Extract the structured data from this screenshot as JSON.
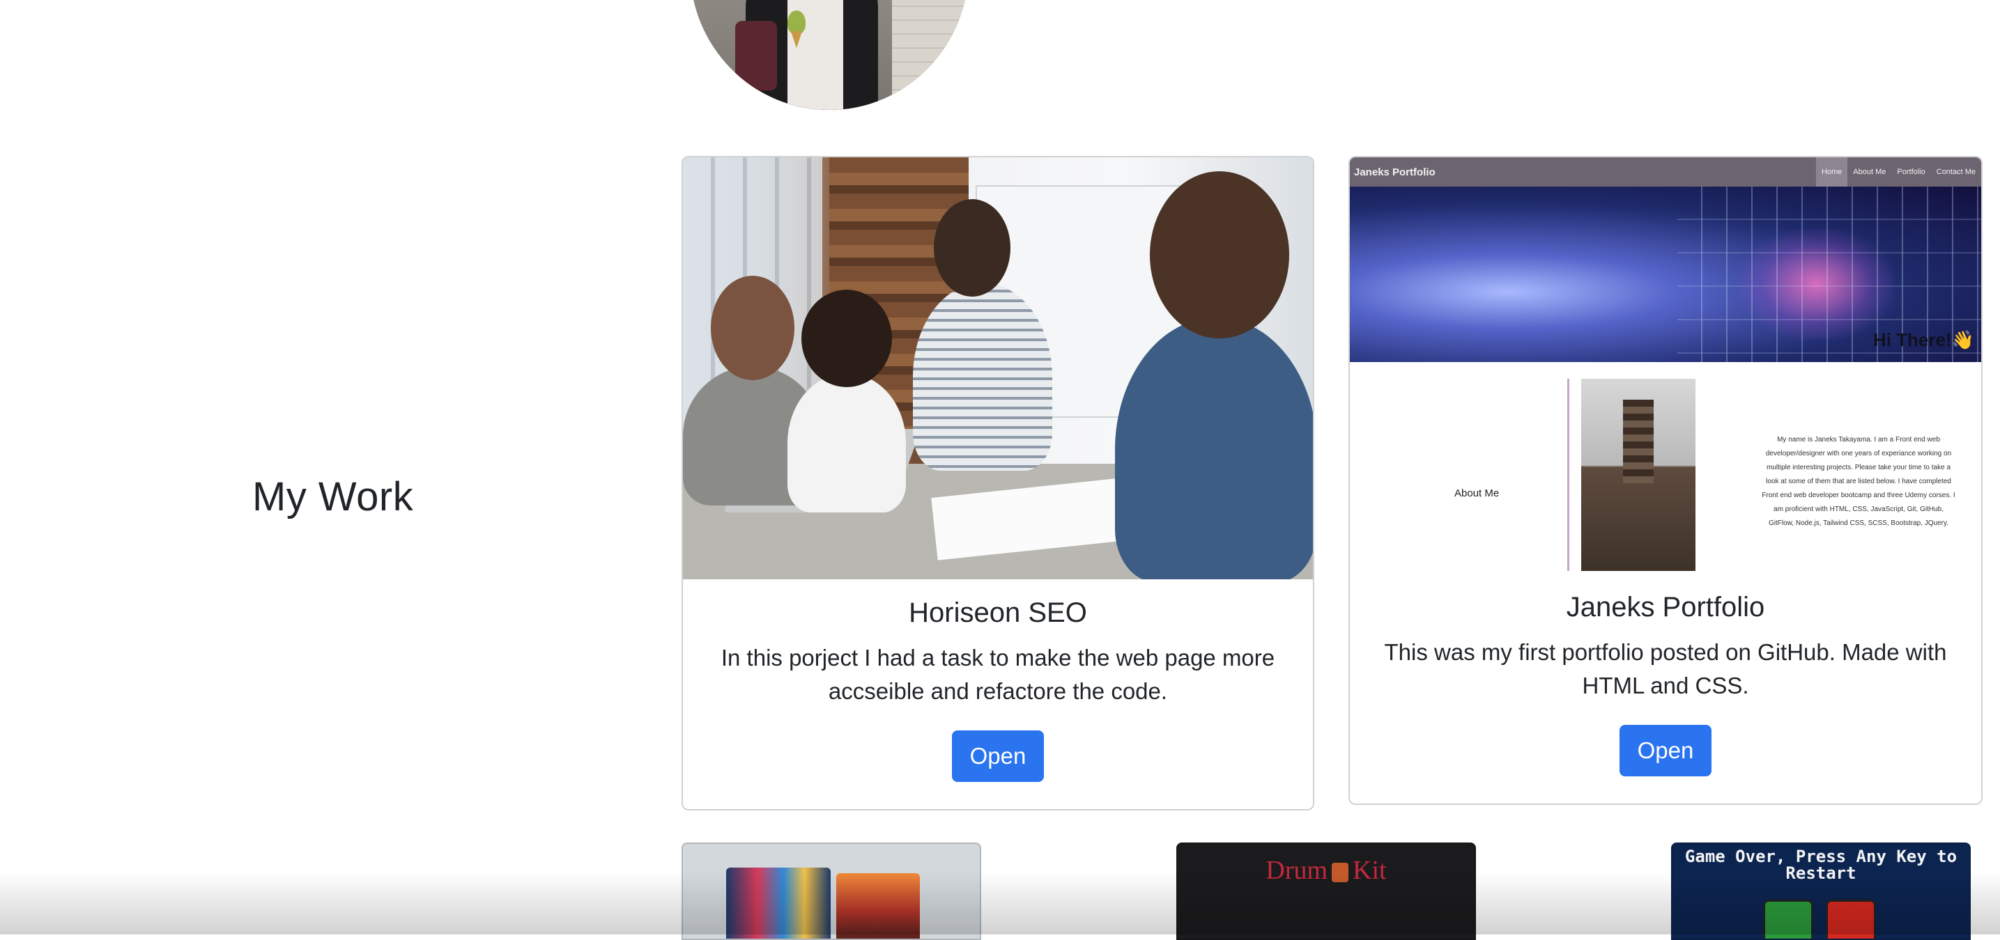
{
  "section": {
    "title": "My Work"
  },
  "projects": [
    {
      "title": "Horiseon SEO",
      "description": "In this porject I had a task to make the web page more accseible and refactore the code.",
      "button_label": "Open"
    },
    {
      "title": "Janeks Portfolio",
      "description": "This was my first portfolio posted on GitHub. Made with HTML and CSS.",
      "button_label": "Open",
      "screenshot": {
        "nav_title": "Janeks Portfolio",
        "nav_links": [
          "Home",
          "About Me",
          "Portfolio",
          "Contact Me"
        ],
        "hero_text": "Hi There!👋",
        "about_label": "About Me",
        "about_text": "My name is Janeks Takayama. I am a Front end web developer/designer with one years of experiance working on multiple interesting projects. Please take your time to take a look at some of them that are listed below. I have completed Front end web developer bootcamp and three Udemy corses. I am proficient with HTML, CSS, JavaScript, Git, GitHub, GitFlow, Node.js, Tailwind CSS, SCSS, Bootstrap, JQuery."
      }
    }
  ],
  "thumbnails": {
    "drum_kit_title_left": "Drum",
    "drum_kit_title_right": "Kit",
    "game_text": "Game Over, Press Any Key to Restart"
  },
  "icons": {
    "drum": "drum-icon"
  }
}
